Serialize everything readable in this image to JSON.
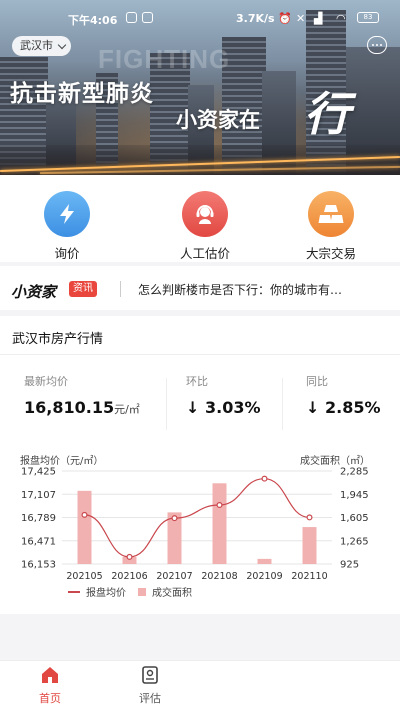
{
  "status_bar": {
    "time": "下午4:06",
    "speed": "3.7K/s",
    "battery": "83"
  },
  "banner": {
    "city": "武汉市",
    "watermark": "FIGHTING",
    "headline_line1": "抗击新型肺炎",
    "headline_line2": "小资家在",
    "headline_script": "行"
  },
  "quick_actions": [
    {
      "label": "询价",
      "icon": "lightning-icon",
      "color": "#4aa3ee"
    },
    {
      "label": "人工估价",
      "icon": "customer-service-icon",
      "color": "#ee5a55"
    },
    {
      "label": "大宗交易",
      "icon": "gold-bars-icon",
      "color": "#f39a48"
    }
  ],
  "news": {
    "brand": "小资家",
    "tag": "资讯",
    "headline": "怎么判断楼市是否下行：你的城市有…"
  },
  "market": {
    "title": "武汉市房产行情",
    "latest_label": "最新均价",
    "latest_value": "16,810.15",
    "latest_unit": "元/㎡",
    "mom_label": "环比",
    "mom_value": "↓ 3.03%",
    "yoy_label": "同比",
    "yoy_value": "↓ 2.85%"
  },
  "chart_data": {
    "type": "bar+line",
    "categories": [
      "202105",
      "202106",
      "202107",
      "202108",
      "202109",
      "202110"
    ],
    "y_left_label": "报盘均价（元/㎡）",
    "y_right_label": "成交面积（㎡）",
    "y_left_ticks": [
      "17,425",
      "17,107",
      "16,789",
      "16,471",
      "16,153"
    ],
    "y_left_range": [
      16153,
      17425
    ],
    "y_right_ticks": [
      "2,285",
      "1,945",
      "1,605",
      "1,265",
      "925"
    ],
    "y_right_range": [
      925,
      2285
    ],
    "series": [
      {
        "name": "报盘均价",
        "type": "line",
        "values": [
          16825,
          16250,
          16780,
          16960,
          17320,
          16790
        ]
      },
      {
        "name": "成交面积",
        "type": "bar",
        "values": [
          1995,
          1030,
          1680,
          2105,
          1000,
          1465
        ]
      }
    ],
    "colors": {
      "line": "#c9474d",
      "bar": "#f2b1b1"
    }
  },
  "tabs": [
    {
      "label": "首页",
      "icon": "home-icon",
      "active": true
    },
    {
      "label": "评估",
      "icon": "report-icon",
      "active": false
    }
  ]
}
